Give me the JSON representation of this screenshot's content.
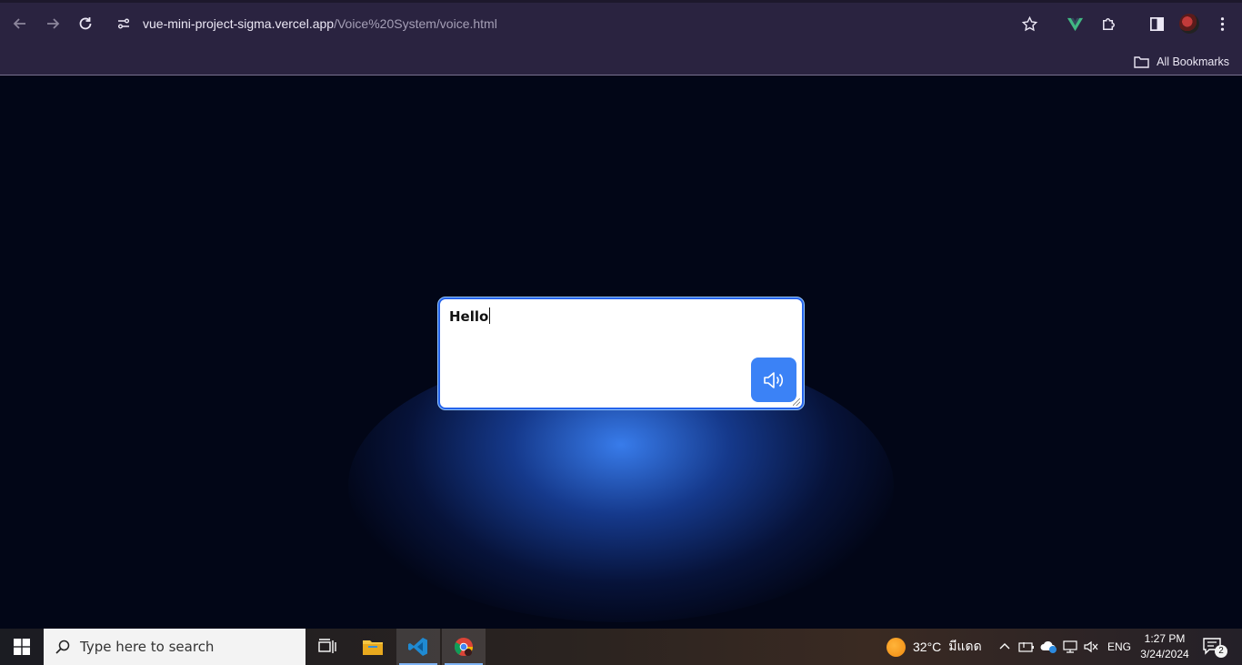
{
  "browser": {
    "url_host": "vue-mini-project-sigma.vercel.app",
    "url_path": "/Voice%20System/voice.html",
    "bookmarks_label": "All Bookmarks",
    "icons": [
      "back-arrow-icon",
      "forward-arrow-icon",
      "reload-icon",
      "site-settings-icon",
      "star-icon",
      "vue-extension-icon",
      "extensions-puzzle-icon",
      "side-panel-icon",
      "profile-avatar",
      "more-menu-icon",
      "folder-icon"
    ]
  },
  "page": {
    "text_value": "Hello",
    "speak_button_icon": "speaker-icon",
    "colors": {
      "background": "#020617",
      "accent": "#3b82f6",
      "border": "#2563eb"
    }
  },
  "taskbar": {
    "search_placeholder": "Type here to search",
    "weather_temp": "32°C",
    "weather_desc": "มีแดด",
    "language": "ENG",
    "time": "1:27 PM",
    "date": "3/24/2024",
    "notification_count": "2"
  }
}
